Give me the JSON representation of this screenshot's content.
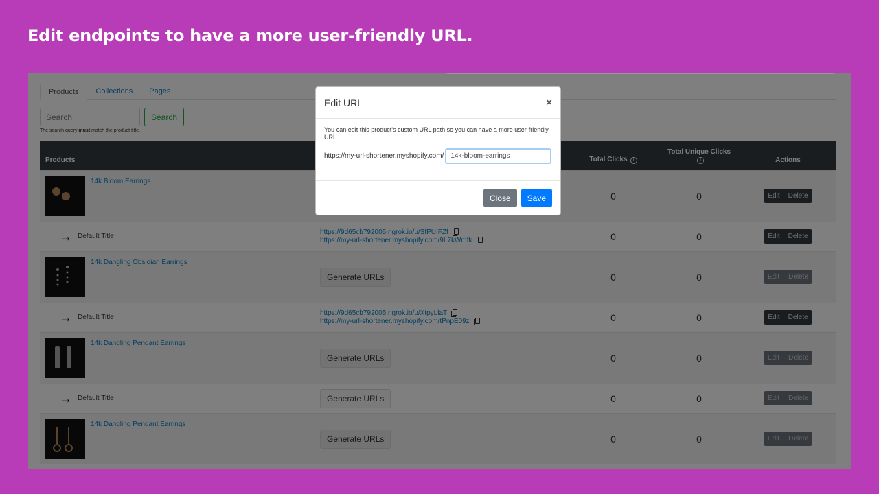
{
  "headline": "Edit endpoints to have a more user-friendly URL.",
  "tabs": [
    {
      "label": "Products",
      "active": true
    },
    {
      "label": "Collections",
      "active": false
    },
    {
      "label": "Pages",
      "active": false
    }
  ],
  "search": {
    "placeholder": "Search",
    "button_label": "Search",
    "hint_prefix": "The search query ",
    "hint_bold": "must",
    "hint_suffix": " match the product title."
  },
  "table": {
    "headers": {
      "products": "Products",
      "total_clicks": "Total Clicks",
      "total_unique_clicks": "Total Unique Clicks",
      "actions": "Actions"
    },
    "action_labels": {
      "edit": "Edit",
      "delete": "Delete"
    },
    "generate_label": "Generate URLs",
    "rows": [
      {
        "type": "product",
        "title": "14k Bloom Earrings",
        "total_clicks": "0",
        "unique_clicks": "0",
        "actions_enabled": true
      },
      {
        "type": "variant",
        "title": "Default Title",
        "url1": "https://9d65cb792005.ngrok.io/u/SfPUIFZf",
        "url2": "https://my-url-shortener.myshopify.com/9L7kWmfk",
        "total_clicks": "0",
        "unique_clicks": "0",
        "actions_enabled": true
      },
      {
        "type": "product",
        "title": "14k Dangling Obsidian Earrings",
        "total_clicks": "0",
        "unique_clicks": "0",
        "actions_enabled": false
      },
      {
        "type": "variant",
        "title": "Default Title",
        "url1": "https://9d65cb792005.ngrok.io/u/XtpyLlaT",
        "url2": "https://my-url-shortener.myshopify.com/tPnpE09z",
        "total_clicks": "0",
        "unique_clicks": "0",
        "actions_enabled": true
      },
      {
        "type": "product",
        "title": "14k Dangling Pendant Earrings",
        "total_clicks": "0",
        "unique_clicks": "0",
        "actions_enabled": false
      },
      {
        "type": "variant",
        "title": "Default Title",
        "total_clicks": "0",
        "unique_clicks": "0",
        "actions_enabled": false
      },
      {
        "type": "product",
        "title": "14k Dangling Pendant Earrings",
        "total_clicks": "0",
        "unique_clicks": "0",
        "actions_enabled": false
      }
    ]
  },
  "modal": {
    "title": "Edit URL",
    "close_icon": "×",
    "description": "You can edit this product's custom URL path so you can have a more user-friendly URL.",
    "url_prefix": "https://my-url-shortener.myshopify.com/",
    "path_value": "14k-bloom-earrings",
    "close_label": "Close",
    "save_label": "Save"
  },
  "colors": {
    "background": "#b83cb8",
    "primary": "#007bff",
    "secondary": "#6c757d",
    "success": "#28a745",
    "dark": "#343a40",
    "link": "#0d7fc4"
  }
}
